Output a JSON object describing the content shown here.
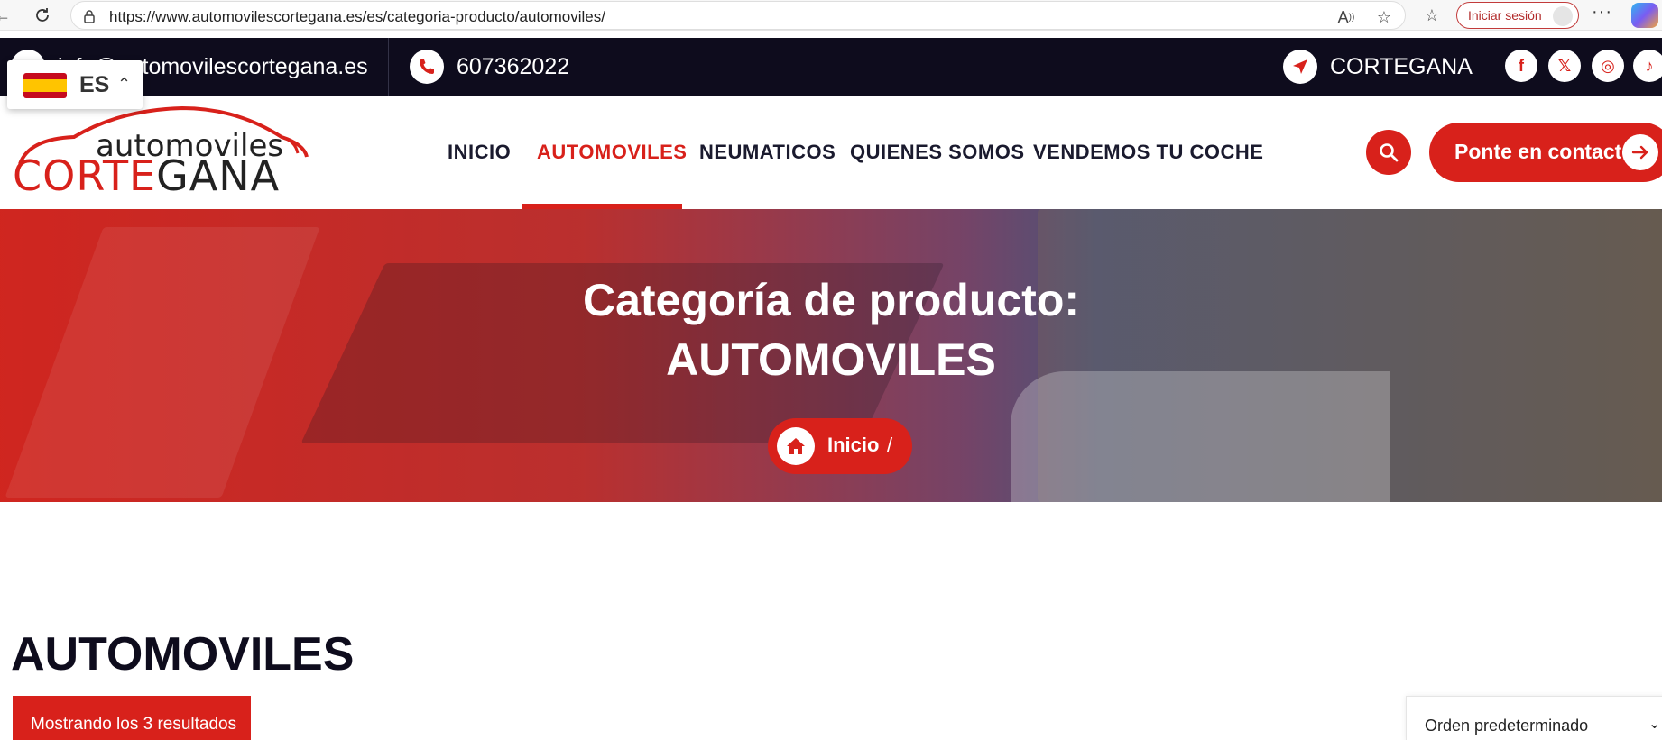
{
  "browser": {
    "url": "https://www.automovilescortegana.es/es/categoria-producto/automoviles/",
    "signin_label": "Iniciar sesión",
    "more_label": "···"
  },
  "topbar": {
    "email": "info@automovilescortegana.es",
    "phone": "607362022",
    "location": "CORTEGANA",
    "socials": [
      "facebook-icon",
      "x-icon",
      "instagram-icon",
      "tiktok-icon"
    ],
    "social_glyphs": {
      "facebook": "f",
      "x": "𝕏",
      "instagram": "◎",
      "tiktok": "♪"
    }
  },
  "language": {
    "code": "ES",
    "chevron": "⌃"
  },
  "logo": {
    "line1": "automoviles",
    "line2a": "CORTE",
    "line2b": "GANA"
  },
  "nav": {
    "items": [
      "INICIO",
      "AUTOMOVILES",
      "NEUMATICOS",
      "QUIENES SOMOS",
      "VENDEMOS TU COCHE"
    ],
    "active": "AUTOMOVILES"
  },
  "header": {
    "contact_label": "Ponte en contacto"
  },
  "hero": {
    "title_line1": "Categoría de producto:",
    "title_line2": "AUTOMOVILES",
    "breadcrumb_home": "Inicio",
    "breadcrumb_sep": "/"
  },
  "content": {
    "heading": "AUTOMOVILES",
    "results_text": "Mostrando los 3 resultados",
    "orderby_value": "Orden predeterminado",
    "orderby_chevron": "⌄"
  },
  "colors": {
    "accent": "#d8211b",
    "dark": "#0e0c1d"
  }
}
